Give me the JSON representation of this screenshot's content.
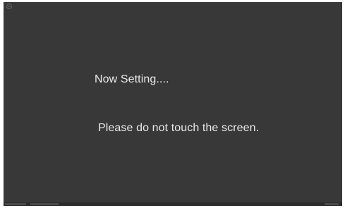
{
  "dialog": {
    "title": "Now Setting....",
    "message": "Please do not touch the screen."
  },
  "colors": {
    "screen_background": "#383838",
    "text": "#eaeaea"
  },
  "icons": {
    "corner": "settings-icon"
  }
}
